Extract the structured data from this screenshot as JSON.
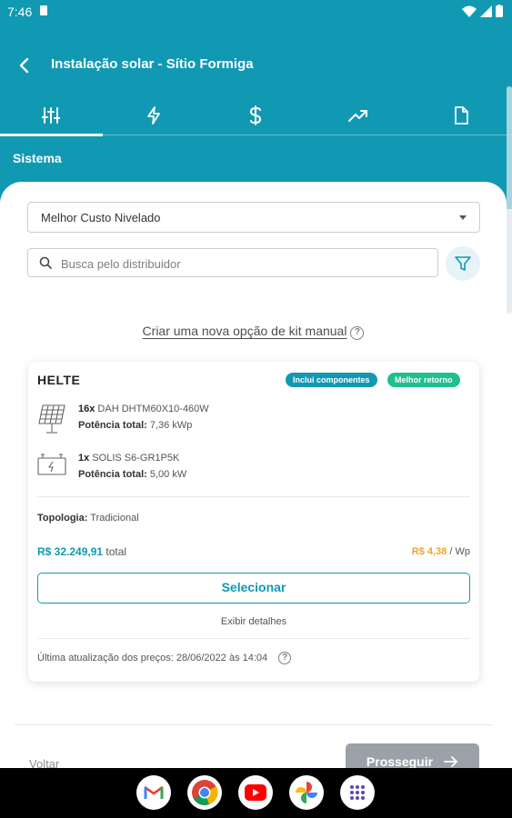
{
  "status_bar": {
    "time": "7:46"
  },
  "app_bar": {
    "title": "Instalação solar - Sítio Formiga"
  },
  "tabs": [
    {
      "icon": "sliders-icon",
      "active": true
    },
    {
      "icon": "lightning-icon",
      "active": false
    },
    {
      "icon": "dollar-icon",
      "active": false
    },
    {
      "icon": "trending-up-icon",
      "active": false
    },
    {
      "icon": "document-icon",
      "active": false
    }
  ],
  "section": {
    "title": "Sistema"
  },
  "sort_select": {
    "value": "Melhor Custo Nivelado"
  },
  "search": {
    "placeholder": "Busca pelo distribuidor",
    "value": ""
  },
  "manual_kit": {
    "label": "Criar uma nova opção de kit manual"
  },
  "kit_card": {
    "brand": "HELTE",
    "badges": {
      "components": "Inclui componentes",
      "best_return": "Melhor retorno"
    },
    "panels": {
      "qty": "16x",
      "model": "DAH DHTM60X10-460W",
      "power_label": "Potência total:",
      "power_value": "7,36 kWp"
    },
    "inverter": {
      "qty": "1x",
      "model": "SOLIS S6-GR1P5K",
      "power_label": "Potência total:",
      "power_value": "5,00 kW"
    },
    "topology": {
      "label": "Topologia:",
      "value": "Tradicional"
    },
    "price": {
      "amount": "R$ 32.249,91",
      "suffix": "total"
    },
    "price_per_wp": {
      "amount": "R$ 4,38",
      "suffix": "/ Wp"
    },
    "select_label": "Selecionar",
    "details_label": "Exibir detalhes",
    "updated": "Última atualização dos preços: 28/06/2022 às 14:04"
  },
  "footer": {
    "back_label": "Voltar",
    "next_label": "Prosseguir"
  },
  "colors": {
    "primary": "#1199b3",
    "success": "#1fbf8f",
    "accent": "#f0a430",
    "disabled": "#9aa1a8"
  },
  "dock_apps": [
    "Gmail",
    "Chrome",
    "YouTube",
    "Google Photos",
    "App drawer"
  ]
}
